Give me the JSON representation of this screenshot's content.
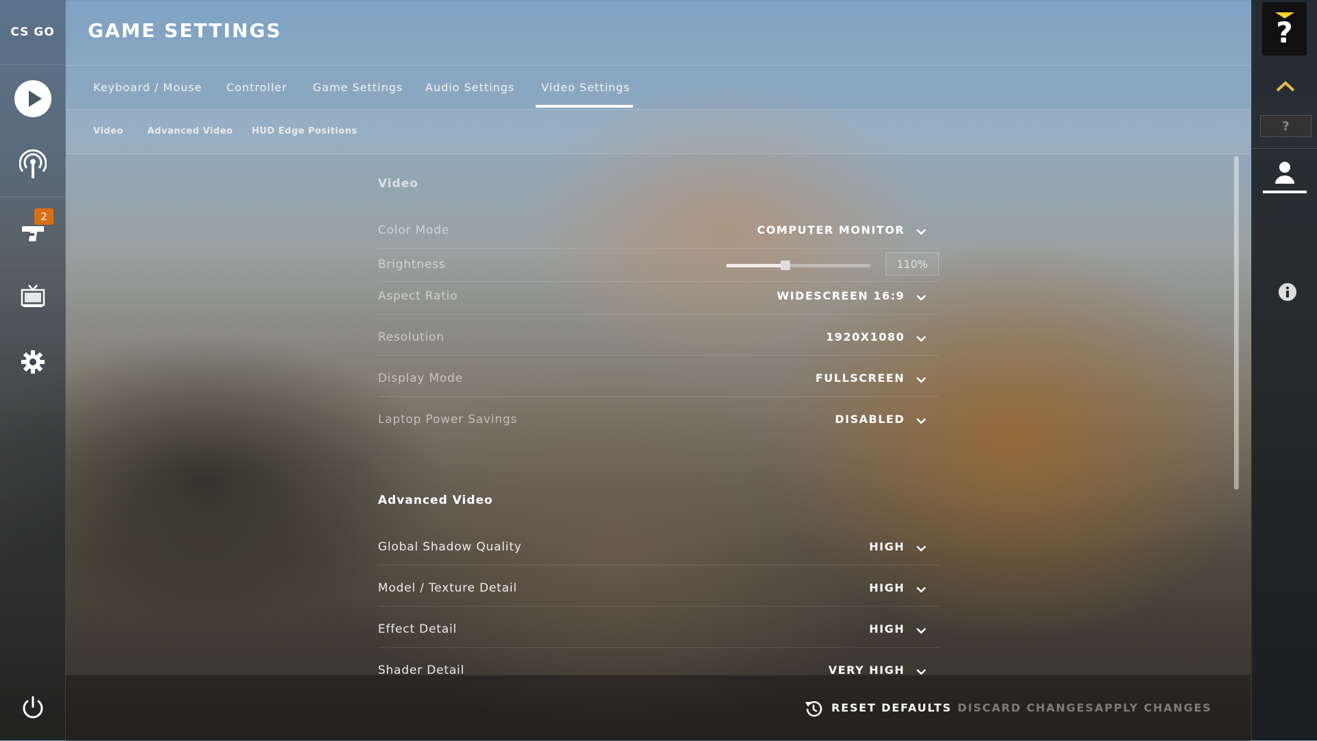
{
  "app": {
    "logo": "CS GO",
    "title": "GAME SETTINGS"
  },
  "sidebar": {
    "items": [
      {
        "name": "play-icon"
      },
      {
        "name": "broadcast-icon"
      },
      {
        "name": "inventory-icon",
        "badge": "2"
      },
      {
        "name": "tv-icon"
      },
      {
        "name": "gear-icon"
      },
      {
        "name": "power-icon"
      }
    ]
  },
  "tabs": [
    {
      "label": "Keyboard / Mouse"
    },
    {
      "label": "Controller"
    },
    {
      "label": "Game Settings"
    },
    {
      "label": "Audio Settings"
    },
    {
      "label": "Video Settings",
      "active": true
    }
  ],
  "subtabs": [
    {
      "label": "Video"
    },
    {
      "label": "Advanced Video"
    },
    {
      "label": "HUD Edge Positions"
    }
  ],
  "sections": {
    "video": {
      "title": "Video",
      "color_mode": {
        "label": "Color Mode",
        "value": "COMPUTER MONITOR"
      },
      "brightness": {
        "label": "Brightness",
        "value": "110%",
        "slider_fraction": 0.41
      },
      "aspect_ratio": {
        "label": "Aspect Ratio",
        "value": "WIDESCREEN 16:9"
      },
      "resolution": {
        "label": "Resolution",
        "value": "1920X1080"
      },
      "display_mode": {
        "label": "Display Mode",
        "value": "FULLSCREEN"
      },
      "laptop_power": {
        "label": "Laptop Power Savings",
        "value": "DISABLED"
      }
    },
    "advanced": {
      "title": "Advanced Video",
      "shadow": {
        "label": "Global Shadow Quality",
        "value": "HIGH"
      },
      "model_texture": {
        "label": "Model / Texture Detail",
        "value": "HIGH"
      },
      "effect": {
        "label": "Effect Detail",
        "value": "HIGH"
      },
      "shader": {
        "label": "Shader Detail",
        "value": "VERY HIGH"
      }
    }
  },
  "footer": {
    "reset": "RESET DEFAULTS",
    "discard": "DISCARD CHANGES",
    "apply": "APPLY CHANGES"
  },
  "rightbar": {
    "help": "?",
    "small_help": "?"
  },
  "colors": {
    "badge": "#d86f14",
    "help_accent": "#f5d327",
    "chevron_up": "#e8b84a"
  }
}
